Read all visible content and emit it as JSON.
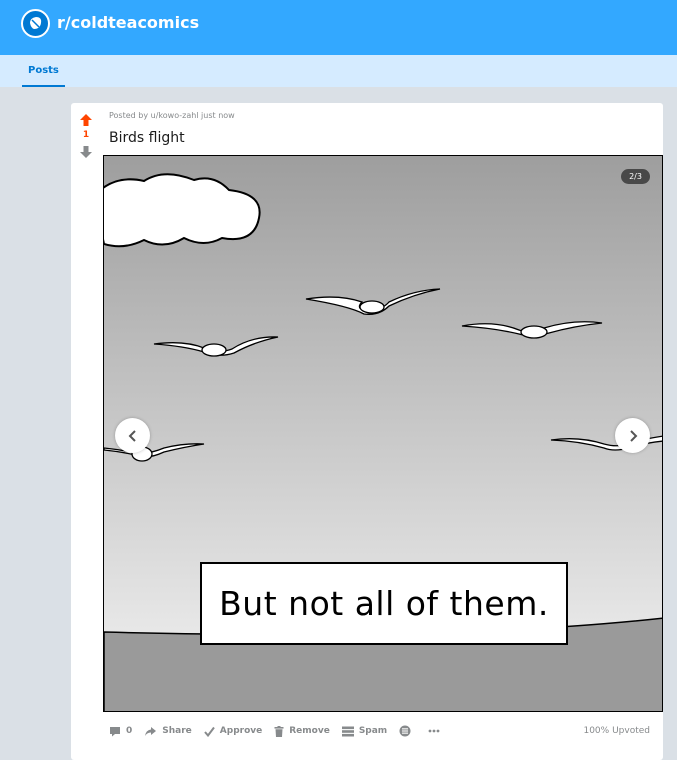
{
  "header": {
    "subreddit": "r/coldteacomics"
  },
  "tabs": [
    {
      "label": "Posts",
      "active": true
    }
  ],
  "post": {
    "score": "1",
    "meta": "Posted by u/kowo-zahl just now",
    "title": "Birds flight",
    "gallery": {
      "counter": "2/3",
      "caption": "But not all of them."
    },
    "actions": {
      "comments": "0",
      "share": "Share",
      "approve": "Approve",
      "remove": "Remove",
      "spam": "Spam"
    },
    "upvoted": "100% Upvoted"
  },
  "colors": {
    "brand_blue": "#0079d3",
    "header_blue": "#33a8ff",
    "upvote_orange": "#ff4500",
    "page_bg": "#dae0e6"
  }
}
